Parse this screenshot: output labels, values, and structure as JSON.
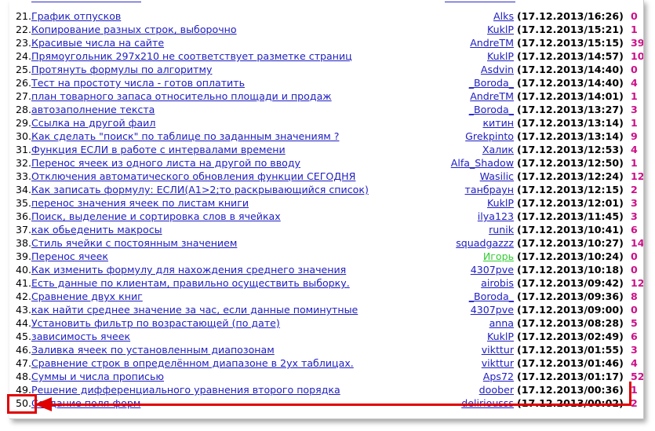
{
  "rows": [
    {
      "n": "21.",
      "title": "График отпусков",
      "author": "Alks",
      "date": "(17.12.2013/16:26)",
      "count": "0"
    },
    {
      "n": "22.",
      "title": "Копирование разных строк, выборочно",
      "author": "KuklP",
      "date": "(17.12.2013/15:21)",
      "count": "1"
    },
    {
      "n": "23.",
      "title": "Красивые числа на сайте",
      "author": "AndreTM",
      "date": "(17.12.2013/15:15)",
      "count": "39"
    },
    {
      "n": "24.",
      "title": "Прямоугольник 297х210 не соответствует разметке страниц",
      "author": "KuklP",
      "date": "(17.12.2013/14:57)",
      "count": "10"
    },
    {
      "n": "25.",
      "title": "Протянуть формулы по алгоритму",
      "author": "Asdvin",
      "date": "(17.12.2013/14:40)",
      "count": "0"
    },
    {
      "n": "26.",
      "title": "Тест на простоту числа - готов оплатить",
      "author": "_Boroda_",
      "date": "(17.12.2013/14:40)",
      "count": "4"
    },
    {
      "n": "27.",
      "title": "план товарного запаса относительно площади и продаж",
      "author": "AndreTM",
      "date": "(17.12.2013/14:01)",
      "count": "1"
    },
    {
      "n": "28.",
      "title": "автозаполнение текста",
      "author": "_Boroda_",
      "date": "(17.12.2013/13:27)",
      "count": "3"
    },
    {
      "n": "29.",
      "title": "Ссылка на другой фаил",
      "author": "китин",
      "date": "(17.12.2013/13:14)",
      "count": "1"
    },
    {
      "n": "30.",
      "title": "Как сделать \"поиск\" по таблице по заданным значениям ?",
      "author": "Grekpinto",
      "date": "(17.12.2013/13:14)",
      "count": "9"
    },
    {
      "n": "31.",
      "title": "Функция ЕСЛИ в работе с интервалами времени",
      "author": "Халик",
      "date": "(17.12.2013/12:53)",
      "count": "4"
    },
    {
      "n": "32.",
      "title": "Перенос ячеек из одного листа на другой по вводу",
      "author": "Alfa_Shadow",
      "date": "(17.12.2013/12:50)",
      "count": "1"
    },
    {
      "n": "33.",
      "title": "Отключения автоматического обновления функции СЕГОДНЯ",
      "author": "Wasilic",
      "date": "(17.12.2013/12:24)",
      "count": "12"
    },
    {
      "n": "34.",
      "title": "Как записать формулу: ЕСЛИ(A1>2;то раскрывающийся список)",
      "author": "танбраун",
      "date": "(17.12.2013/12:15)",
      "count": "2"
    },
    {
      "n": "35.",
      "title": "перенос значения ячеек по листам книги",
      "author": "KuklP",
      "date": "(17.12.2013/12:01)",
      "count": "3"
    },
    {
      "n": "36.",
      "title": "Поиск, выделение и сортировка слов в ячейках",
      "author": "ilya123",
      "date": "(17.12.2013/11:45)",
      "count": "3"
    },
    {
      "n": "37.",
      "title": "как обьеденить макросы",
      "author": "runik",
      "date": "(17.12.2013/10:41)",
      "count": "6"
    },
    {
      "n": "38.",
      "title": "Стиль ячейки с постоянным значением",
      "author": "squadgazzz",
      "date": "(17.12.2013/10:27)",
      "count": "14"
    },
    {
      "n": "39.",
      "title": "Перенос ячеек",
      "author": "Игорь",
      "date": "(17.12.2013/10:24)",
      "count": "0",
      "green": true
    },
    {
      "n": "40.",
      "title": "Как изменить формулу для нахождения среднего значения",
      "author": "4307pve",
      "date": "(17.12.2013/10:18)",
      "count": "0"
    },
    {
      "n": "41.",
      "title": "Есть данные по клиентам, правильно осуществить выборку.",
      "author": "airobis",
      "date": "(17.12.2013/09:42)",
      "count": "12"
    },
    {
      "n": "42.",
      "title": "Сравнение двух книг",
      "author": "_Boroda_",
      "date": "(17.12.2013/09:36)",
      "count": "8"
    },
    {
      "n": "43.",
      "title": "как найти среднее значение за час, если данные поминутные",
      "author": "4307pve",
      "date": "(17.12.2013/09:00)",
      "count": "0"
    },
    {
      "n": "44.",
      "title": "Установить фильтр по возрастающей (по дате)",
      "author": "anna",
      "date": "(17.12.2013/08:28)",
      "count": "5"
    },
    {
      "n": "45.",
      "title": "зависимость ячеек",
      "author": "KuklP",
      "date": "(17.12.2013/02:49)",
      "count": "6"
    },
    {
      "n": "46.",
      "title": "Заливка ячеек по установленным диапозонам",
      "author": "vikttur",
      "date": "(17.12.2013/01:55)",
      "count": "3"
    },
    {
      "n": "47.",
      "title": "Сравнение строк в определённом диапазоне в 2ух таблицах.",
      "author": "vikttur",
      "date": "(17.12.2013/01:46)",
      "count": "4"
    },
    {
      "n": "48.",
      "title": "Суммы и числа прописью",
      "author": "Aps72",
      "date": "(17.12.2013/01:17)",
      "count": "52"
    },
    {
      "n": "49.",
      "title": "Решение дифференциального уравнения второго порядка",
      "author": "doober",
      "date": "(17.12.2013/00:36)",
      "count": "1"
    },
    {
      "n": "50.",
      "title": "Создание поля форм",
      "author": "deliriousss",
      "date": "(17.12.2013/00:02)",
      "count": "2"
    }
  ],
  "colors": {
    "link": "#2020c0",
    "highlight": "#e00000",
    "count": "#cc1188",
    "online_user": "#33cc33"
  }
}
